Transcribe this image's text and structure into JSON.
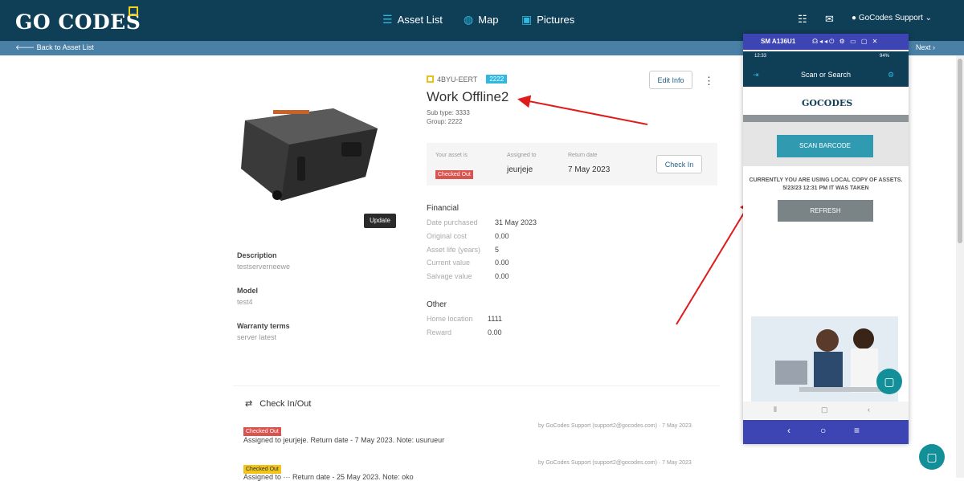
{
  "topbar": {
    "logo": "GO CODES",
    "nav": [
      {
        "label": "Asset List",
        "icon": "list-icon"
      },
      {
        "label": "Map",
        "icon": "globe-icon"
      },
      {
        "label": "Pictures",
        "icon": "image-icon"
      }
    ],
    "user": "GoCodes Support"
  },
  "subbar": {
    "back": "Back to Asset List",
    "next": "Next"
  },
  "asset": {
    "code": "4BYU-EERT",
    "group_tag": "2222",
    "title": "Work Offline2",
    "subtype": "Sub type: 3333",
    "group": "Group: 2222",
    "edit_label": "Edit Info",
    "update_label": "Update"
  },
  "details": [
    {
      "label": "Description",
      "value": "testserverneewe"
    },
    {
      "label": "Model",
      "value": "test4"
    },
    {
      "label": "Warranty terms",
      "value": "server latest"
    }
  ],
  "status": {
    "asset_is_label": "Your asset is",
    "asset_is_value": "Checked Out",
    "assigned_label": "Assigned to",
    "assigned_value": "jeurjeje",
    "return_label": "Return date",
    "return_value": "7 May 2023",
    "checkin_label": "Check In"
  },
  "financial": {
    "title": "Financial",
    "rows": [
      {
        "k": "Date purchased",
        "v": "31 May 2023"
      },
      {
        "k": "Original cost",
        "v": "0.00"
      },
      {
        "k": "Asset life (years)",
        "v": "5"
      },
      {
        "k": "Current value",
        "v": "0.00"
      },
      {
        "k": "Salvage value",
        "v": "0.00"
      }
    ]
  },
  "other": {
    "title": "Other",
    "rows": [
      {
        "k": "Home location",
        "v": "1111"
      },
      {
        "k": "Reward",
        "v": "0.00"
      }
    ]
  },
  "history": {
    "title": "Check In/Out",
    "entries": [
      {
        "badge": "Checked Out",
        "text": "Assigned to jeurjeje. Return date - 7 May 2023. Note: usurueur",
        "by": "by GoCodes Support (support2@gocodes.com) · 7 May 2023"
      },
      {
        "badge": "Checked Out",
        "text": "Assigned to ··· Return date - 25 May 2023. Note: oko",
        "by": "by GoCodes Support (support2@gocodes.com) · 7 May 2023"
      }
    ]
  },
  "phone": {
    "window_title": "SM A136U1",
    "time": "12:33",
    "battery": "94%",
    "header": "Scan or Search",
    "logo": "GOCODES",
    "scan_label": "SCAN BARCODE",
    "message": "CURRENTLY YOU ARE USING LOCAL COPY OF ASSETS. 5/23/23 12:31 PM IT WAS TAKEN",
    "refresh_label": "REFRESH"
  },
  "colors": {
    "topbar": "#0f3f56",
    "subbar": "#4a7fa6",
    "accent": "#2fb9e0",
    "phone_bar": "#3d45b4",
    "arrow": "#e01b1b"
  }
}
